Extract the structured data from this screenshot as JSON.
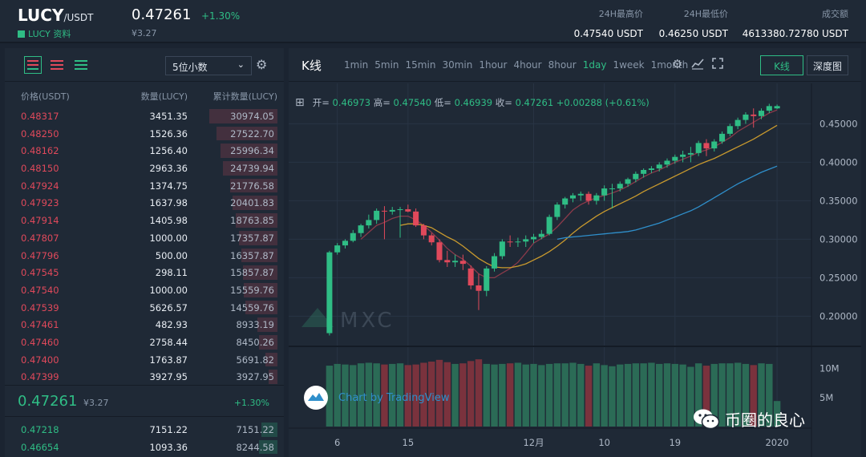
{
  "header": {
    "pair": "LUCY",
    "quote": "/USDT",
    "info_link": "LUCY 资料",
    "price": "0.47261",
    "change": "+1.30%",
    "price_cny": "¥3.27",
    "stats": [
      {
        "label": "24H最高价",
        "value": "0.47540 USDT"
      },
      {
        "label": "24H最低价",
        "value": "0.46250 USDT"
      },
      {
        "label": "成交额",
        "value": "4613380.72780 USDT"
      }
    ]
  },
  "orderbook": {
    "decimals": "5位小数",
    "columns": [
      "价格(USDT)",
      "数量(LUCY)",
      "累计数量(LUCY)"
    ],
    "asks": [
      {
        "price": "0.48317",
        "qty": "3451.35",
        "total": "30974.05",
        "depth": 1.0
      },
      {
        "price": "0.48250",
        "qty": "1526.36",
        "total": "27522.70",
        "depth": 0.89
      },
      {
        "price": "0.48162",
        "qty": "1256.40",
        "total": "25996.34",
        "depth": 0.84
      },
      {
        "price": "0.48150",
        "qty": "2963.36",
        "total": "24739.94",
        "depth": 0.8
      },
      {
        "price": "0.47924",
        "qty": "1374.75",
        "total": "21776.58",
        "depth": 0.7
      },
      {
        "price": "0.47923",
        "qty": "1637.98",
        "total": "20401.83",
        "depth": 0.66
      },
      {
        "price": "0.47914",
        "qty": "1405.98",
        "total": "18763.85",
        "depth": 0.61
      },
      {
        "price": "0.47807",
        "qty": "1000.00",
        "total": "17357.87",
        "depth": 0.56
      },
      {
        "price": "0.47796",
        "qty": "500.00",
        "total": "16357.87",
        "depth": 0.53
      },
      {
        "price": "0.47545",
        "qty": "298.11",
        "total": "15857.87",
        "depth": 0.51
      },
      {
        "price": "0.47540",
        "qty": "1000.00",
        "total": "15559.76",
        "depth": 0.5
      },
      {
        "price": "0.47539",
        "qty": "5626.57",
        "total": "14559.76",
        "depth": 0.47
      },
      {
        "price": "0.47461",
        "qty": "482.93",
        "total": "8933.19",
        "depth": 0.29
      },
      {
        "price": "0.47460",
        "qty": "2758.44",
        "total": "8450.26",
        "depth": 0.27
      },
      {
        "price": "0.47400",
        "qty": "1763.87",
        "total": "5691.82",
        "depth": 0.18
      },
      {
        "price": "0.47399",
        "qty": "3927.95",
        "total": "3927.95",
        "depth": 0.13
      }
    ],
    "mid_price": "0.47261",
    "mid_cny": "¥3.27",
    "mid_change": "+1.30%",
    "bids": [
      {
        "price": "0.47218",
        "qty": "7151.22",
        "total": "7151.22",
        "depth": 0.23
      },
      {
        "price": "0.46654",
        "qty": "1093.36",
        "total": "8244.58",
        "depth": 0.27
      }
    ]
  },
  "chart_panel": {
    "title": "K线",
    "intervals": [
      "1min",
      "5min",
      "15min",
      "30min",
      "1hour",
      "4hour",
      "8hour",
      "1day",
      "1week",
      "1month"
    ],
    "active_interval": "1day",
    "view_kline": "K线",
    "view_depth": "深度图",
    "ohlc": {
      "open_label": "开=",
      "open": "0.46973",
      "high_label": "高=",
      "high": "0.47540",
      "low_label": "低=",
      "low": "0.46939",
      "close_label": "收=",
      "close": "0.47261",
      "change": "+0.00288 (+0.61%)"
    },
    "watermark": "MXC",
    "tradingview": "Chart by TradingView"
  },
  "wechat_label": "币圈的良心",
  "colors": {
    "up": "#2fbd85",
    "down": "#e0495b",
    "ma1": "#c99a2e",
    "ma2": "#2f8fcb"
  },
  "chart_data": {
    "type": "candlestick",
    "ylim": [
      0.165,
      0.49
    ],
    "yticks": [
      0.2,
      0.25,
      0.3,
      0.35,
      0.4,
      0.45
    ],
    "ytick_labels": [
      "0.20000",
      "0.25000",
      "0.30000",
      "0.35000",
      "0.40000",
      "0.45000"
    ],
    "xtick_labels": [
      {
        "label": "6",
        "index": 1
      },
      {
        "label": "15",
        "index": 10
      },
      {
        "label": "12月",
        "index": 26
      },
      {
        "label": "10",
        "index": 35
      },
      {
        "label": "19",
        "index": 44
      },
      {
        "label": "2020",
        "index": 57
      }
    ],
    "vol_ylim": [
      0,
      13000000
    ],
    "vol_ticks": [
      5000000,
      10000000
    ],
    "vol_tick_labels": [
      "5M",
      "10M"
    ],
    "candles": [
      [
        0.178,
        0.285,
        0.175,
        0.283
      ],
      [
        0.283,
        0.295,
        0.28,
        0.292
      ],
      [
        0.292,
        0.3,
        0.288,
        0.298
      ],
      [
        0.298,
        0.312,
        0.296,
        0.308
      ],
      [
        0.308,
        0.32,
        0.303,
        0.318
      ],
      [
        0.318,
        0.332,
        0.314,
        0.325
      ],
      [
        0.325,
        0.34,
        0.32,
        0.337
      ],
      [
        0.337,
        0.343,
        0.3,
        0.336
      ],
      [
        0.336,
        0.342,
        0.332,
        0.338
      ],
      [
        0.338,
        0.342,
        0.302,
        0.339
      ],
      [
        0.339,
        0.345,
        0.335,
        0.336
      ],
      [
        0.336,
        0.34,
        0.316,
        0.318
      ],
      [
        0.318,
        0.32,
        0.3,
        0.305
      ],
      [
        0.305,
        0.308,
        0.292,
        0.296
      ],
      [
        0.296,
        0.3,
        0.27,
        0.273
      ],
      [
        0.273,
        0.285,
        0.264,
        0.27
      ],
      [
        0.27,
        0.28,
        0.264,
        0.272
      ],
      [
        0.272,
        0.28,
        0.26,
        0.268
      ],
      [
        0.262,
        0.266,
        0.235,
        0.24
      ],
      [
        0.24,
        0.255,
        0.208,
        0.233
      ],
      [
        0.233,
        0.265,
        0.226,
        0.262
      ],
      [
        0.262,
        0.282,
        0.258,
        0.278
      ],
      [
        0.278,
        0.3,
        0.274,
        0.297
      ],
      [
        0.297,
        0.305,
        0.29,
        0.296
      ],
      [
        0.296,
        0.302,
        0.29,
        0.297
      ],
      [
        0.297,
        0.305,
        0.29,
        0.3
      ],
      [
        0.3,
        0.307,
        0.295,
        0.303
      ],
      [
        0.303,
        0.312,
        0.3,
        0.307
      ],
      [
        0.307,
        0.332,
        0.305,
        0.329
      ],
      [
        0.329,
        0.348,
        0.325,
        0.345
      ],
      [
        0.345,
        0.355,
        0.34,
        0.353
      ],
      [
        0.353,
        0.36,
        0.348,
        0.357
      ],
      [
        0.357,
        0.362,
        0.35,
        0.359
      ],
      [
        0.359,
        0.362,
        0.345,
        0.35
      ],
      [
        0.35,
        0.36,
        0.345,
        0.357
      ],
      [
        0.357,
        0.37,
        0.35,
        0.366
      ],
      [
        0.366,
        0.372,
        0.34,
        0.366
      ],
      [
        0.366,
        0.375,
        0.362,
        0.372
      ],
      [
        0.372,
        0.38,
        0.368,
        0.378
      ],
      [
        0.378,
        0.388,
        0.374,
        0.385
      ],
      [
        0.385,
        0.392,
        0.38,
        0.39
      ],
      [
        0.39,
        0.395,
        0.386,
        0.392
      ],
      [
        0.392,
        0.4,
        0.388,
        0.397
      ],
      [
        0.397,
        0.405,
        0.393,
        0.402
      ],
      [
        0.402,
        0.41,
        0.398,
        0.407
      ],
      [
        0.407,
        0.415,
        0.4,
        0.41
      ],
      [
        0.41,
        0.42,
        0.4,
        0.412
      ],
      [
        0.412,
        0.428,
        0.408,
        0.425
      ],
      [
        0.425,
        0.43,
        0.408,
        0.418
      ],
      [
        0.418,
        0.43,
        0.414,
        0.427
      ],
      [
        0.427,
        0.44,
        0.424,
        0.437
      ],
      [
        0.437,
        0.45,
        0.434,
        0.447
      ],
      [
        0.447,
        0.458,
        0.443,
        0.455
      ],
      [
        0.455,
        0.465,
        0.45,
        0.462
      ],
      [
        0.462,
        0.47,
        0.445,
        0.46
      ],
      [
        0.46,
        0.47,
        0.456,
        0.467
      ],
      [
        0.467,
        0.476,
        0.464,
        0.473
      ],
      [
        0.47,
        0.475,
        0.469,
        0.473
      ]
    ],
    "volumes": [
      10.5,
      10.8,
      10.7,
      10.6,
      10.9,
      11.0,
      10.9,
      10.7,
      10.8,
      10.9,
      10.6,
      10.7,
      11.0,
      11.2,
      11.5,
      11.1,
      10.8,
      10.9,
      11.3,
      11.6,
      10.8,
      10.7,
      10.8,
      10.9,
      11.0,
      10.7,
      10.8,
      10.6,
      10.8,
      10.9,
      10.9,
      11.0,
      10.8,
      10.5,
      10.9,
      10.6,
      10.4,
      10.7,
      10.8,
      10.9,
      10.9,
      11.0,
      10.8,
      10.9,
      10.8,
      10.7,
      10.3,
      10.9,
      10.5,
      10.8,
      10.9,
      10.9,
      11.0,
      10.8,
      10.6,
      10.9,
      10.8,
      4.4
    ],
    "ma_fast": [
      null,
      null,
      null,
      null,
      0.3,
      0.309,
      0.318,
      0.322,
      0.327,
      0.33,
      0.33,
      0.325,
      0.318,
      0.309,
      0.299,
      0.288,
      0.28,
      0.274,
      0.265,
      0.255,
      0.25,
      0.25,
      0.256,
      0.262,
      0.27,
      0.282,
      0.295,
      0.301,
      0.307,
      0.316,
      0.327,
      0.338,
      0.345,
      0.35,
      0.354,
      0.357,
      0.36,
      0.364,
      0.369,
      0.375,
      0.381,
      0.386,
      0.39,
      0.395,
      0.4,
      0.404,
      0.408,
      0.413,
      0.416,
      0.42,
      0.426,
      0.432,
      0.44,
      0.446,
      0.452,
      0.458,
      0.464,
      0.468
    ],
    "ma_slow": [
      null,
      null,
      null,
      null,
      null,
      null,
      null,
      null,
      null,
      0.318,
      0.32,
      0.32,
      0.318,
      0.315,
      0.309,
      0.303,
      0.298,
      0.291,
      0.283,
      0.275,
      0.269,
      0.264,
      0.263,
      0.263,
      0.265,
      0.268,
      0.273,
      0.278,
      0.284,
      0.291,
      0.299,
      0.308,
      0.316,
      0.323,
      0.33,
      0.336,
      0.341,
      0.346,
      0.351,
      0.356,
      0.362,
      0.367,
      0.372,
      0.377,
      0.382,
      0.387,
      0.392,
      0.397,
      0.401,
      0.405,
      0.41,
      0.415,
      0.42,
      0.425,
      0.43,
      0.436,
      0.442,
      0.448
    ],
    "ma_long": [
      null,
      null,
      null,
      null,
      null,
      null,
      null,
      null,
      null,
      null,
      null,
      null,
      null,
      null,
      null,
      null,
      null,
      null,
      null,
      null,
      null,
      null,
      null,
      null,
      null,
      null,
      null,
      null,
      null,
      0.3,
      0.302,
      0.303,
      0.304,
      0.305,
      0.306,
      0.307,
      0.308,
      0.309,
      0.31,
      0.312,
      0.315,
      0.318,
      0.321,
      0.325,
      0.329,
      0.333,
      0.337,
      0.342,
      0.348,
      0.354,
      0.36,
      0.366,
      0.372,
      0.377,
      0.382,
      0.387,
      0.391,
      0.395
    ]
  }
}
